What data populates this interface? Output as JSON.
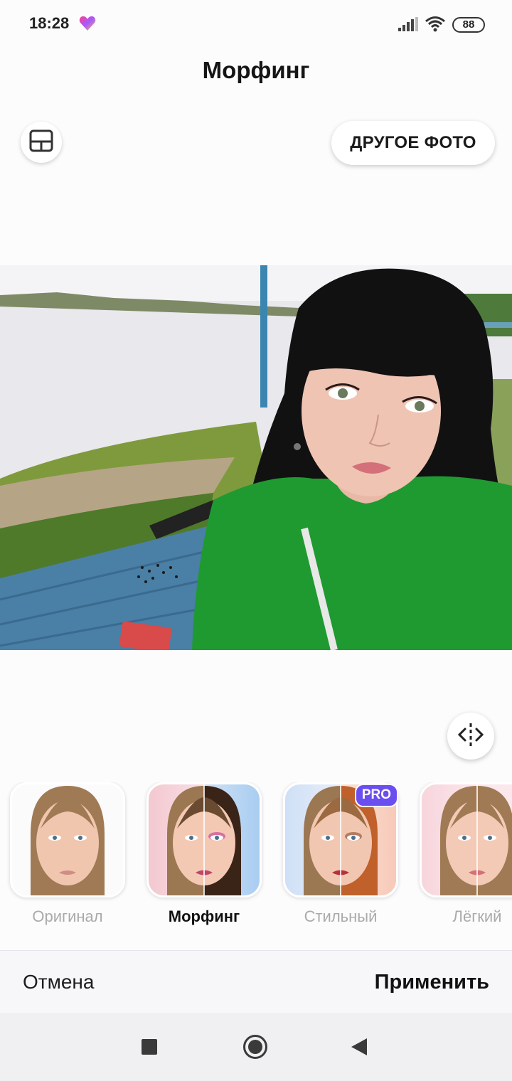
{
  "status": {
    "time": "18:28",
    "battery": "88",
    "icons": [
      "heart-icon",
      "signal-icon",
      "wifi-icon",
      "battery-icon"
    ]
  },
  "header": {
    "title": "Морфинг",
    "other_photo": "ДРУГОЕ ФОТО"
  },
  "icons": {
    "layout": "layout-icon",
    "compare": "compare-icon"
  },
  "filters": [
    {
      "label": "Оригинал",
      "pro": false,
      "selected": false
    },
    {
      "label": "Морфинг",
      "pro": false,
      "selected": true
    },
    {
      "label": "Стильный",
      "pro": true,
      "selected": false
    },
    {
      "label": "Лёгкий",
      "pro": true,
      "selected": false
    }
  ],
  "badge": {
    "pro": "PRO"
  },
  "actions": {
    "cancel": "Отмена",
    "apply": "Применить"
  },
  "colors": {
    "accent": "#6b4ef0",
    "shirt": "#1f9a30",
    "water": "#e9e9ee"
  }
}
